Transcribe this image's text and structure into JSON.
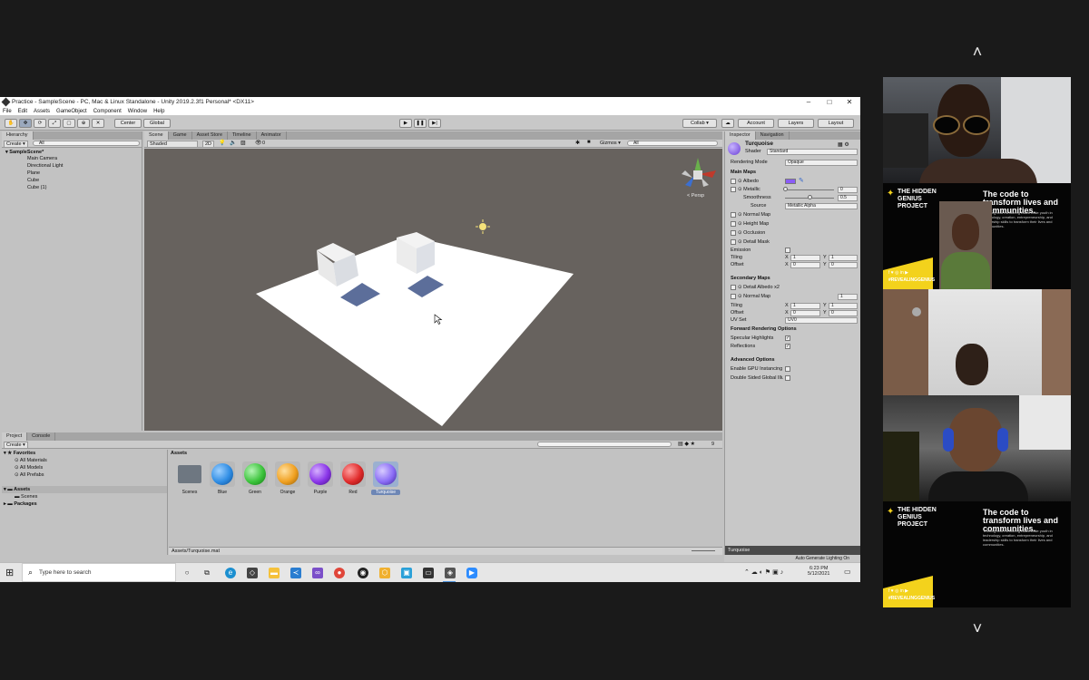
{
  "window": {
    "title": "Practice - SampleScene - PC, Mac & Linux Standalone - Unity 2019.2.3f1 Personal* <DX11>",
    "minimize": "–",
    "maximize": "□",
    "close": "✕"
  },
  "menu": [
    "File",
    "Edit",
    "Assets",
    "GameObject",
    "Component",
    "Window",
    "Help"
  ],
  "toolbar": {
    "pivot": "Center",
    "space": "Global",
    "collab": "Collab ▾",
    "account": "Account",
    "layers": "Layers",
    "layout": "Layout"
  },
  "hierarchy": {
    "tab": "Hierarchy",
    "create": "Create ▾",
    "search": "All",
    "scene": "SampleScene*",
    "items": [
      "Main Camera",
      "Directional Light",
      "Plane",
      "Cube",
      "Cube (1)"
    ]
  },
  "scene_tabs": [
    "Scene",
    "Game",
    "Asset Store",
    "Timeline",
    "Animator"
  ],
  "scene_bar": {
    "shading": "Shaded",
    "mode2d": "2D",
    "fx_count": "0",
    "gizmos": "Gizmos ▾",
    "search": "All"
  },
  "scene_view": {
    "persp": "< Persp"
  },
  "inspector": {
    "tabs": [
      "Inspector",
      "Navigation"
    ],
    "material_name": "Turquoise",
    "shader_label": "Shader",
    "shader_value": "Standard",
    "rendering_mode_label": "Rendering Mode",
    "rendering_mode_value": "Opaque",
    "main_maps": "Main Maps",
    "albedo": "Albedo",
    "metallic": "Metallic",
    "metallic_value": "0",
    "smoothness": "Smoothness",
    "smoothness_value": "0.5",
    "source": "Source",
    "source_value": "Metallic Alpha",
    "normal_map": "Normal Map",
    "height_map": "Height Map",
    "occlusion": "Occlusion",
    "detail_mask": "Detail Mask",
    "emission": "Emission",
    "tiling": "Tiling",
    "offset": "Offset",
    "x": "X",
    "y": "Y",
    "tiling_x": "1",
    "tiling_y": "1",
    "offset_x": "0",
    "offset_y": "0",
    "secondary_maps": "Secondary Maps",
    "detail_albedo": "Detail Albedo x2",
    "normal_map_2": "Normal Map",
    "normal_scale": "1",
    "tiling2_x": "1",
    "tiling2_y": "1",
    "offset2_x": "0",
    "offset2_y": "0",
    "uv_set": "UV Set",
    "uv_set_value": "UV0",
    "forward": "Forward Rendering Options",
    "specular": "Specular Highlights",
    "reflections": "Reflections",
    "advanced": "Advanced Options",
    "gpu_instancing": "Enable GPU Instancing",
    "double_sided": "Double Sided Global Illumination",
    "footer_name": "Turquoise",
    "auto_lighting": "Auto Generate Lighting On",
    "albedo_color": "#8a5cf6"
  },
  "project": {
    "tabs": [
      "Project",
      "Console"
    ],
    "create": "Create ▾",
    "favorites": "Favorites",
    "fav_items": [
      "All Materials",
      "All Models",
      "All Prefabs"
    ],
    "assets": "Assets",
    "asset_children": [
      "Scenes"
    ],
    "packages": "Packages",
    "breadcrumb": "Assets",
    "path": "Assets/Turquoise.mat",
    "count": "9",
    "items": [
      {
        "name": "Scenes",
        "color": "#6e7781"
      },
      {
        "name": "Blue",
        "color": "#2f8de4"
      },
      {
        "name": "Green",
        "color": "#3cc43c"
      },
      {
        "name": "Orange",
        "color": "#f0a020"
      },
      {
        "name": "Purple",
        "color": "#8a35e8"
      },
      {
        "name": "Red",
        "color": "#e02a2a"
      },
      {
        "name": "Turquoise",
        "color": "#8a6cf6"
      }
    ]
  },
  "taskbar": {
    "search_placeholder": "Type here to search",
    "time": "6:23 PM",
    "date": "5/12/2021"
  },
  "gallery": {
    "thg_logo": "THE HIDDEN GENIUS PROJECT",
    "thg_tagline": "The code to transform lives and communities.",
    "thg_small": "Training and mentoring Black male youth in technology, creation, entrepreneurship, and leadership skills to transform their lives and communities.",
    "thg_hashtag": "#REVEALINGGENIUS",
    "up": "˄",
    "down": "˅"
  }
}
